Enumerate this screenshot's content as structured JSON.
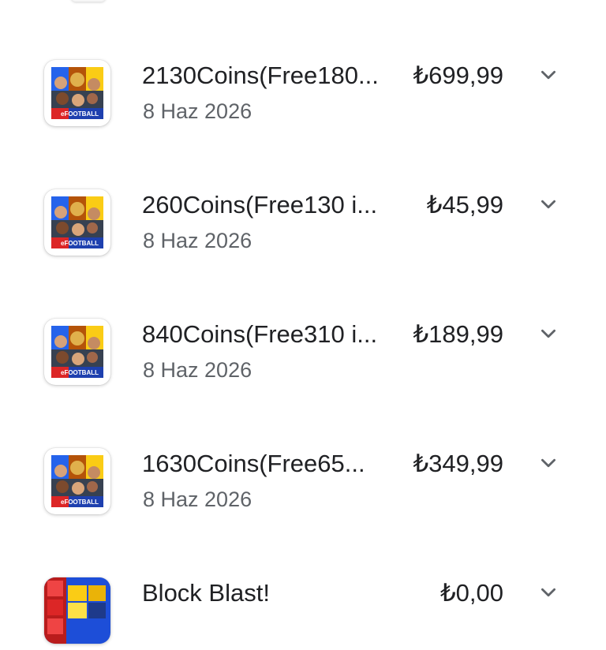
{
  "purchases": [
    {
      "title": "2130Coins(Free180...",
      "date": "8 Haz 2026",
      "price": "₺699,99",
      "icon": "efootball-app-icon",
      "icon_text": "eFOOTBALL"
    },
    {
      "title": "260Coins(Free130 i...",
      "date": "8 Haz 2026",
      "price": "₺45,99",
      "icon": "efootball-app-icon",
      "icon_text": "eFOOTBALL"
    },
    {
      "title": "840Coins(Free310 i...",
      "date": "8 Haz 2026",
      "price": "₺189,99",
      "icon": "efootball-app-icon",
      "icon_text": "eFOOTBALL"
    },
    {
      "title": "1630Coins(Free65...",
      "date": "8 Haz 2026",
      "price": "₺349,99",
      "icon": "efootball-app-icon",
      "icon_text": "eFOOTBALL"
    },
    {
      "title": "Block Blast!",
      "price": "₺0,00",
      "icon": "block-blast-app-icon"
    }
  ],
  "colors": {
    "title_text": "#202124",
    "secondary_text": "#5f6368",
    "chevron": "#5f6368",
    "background": "#ffffff"
  },
  "expand_icon": "chevron-down-icon"
}
